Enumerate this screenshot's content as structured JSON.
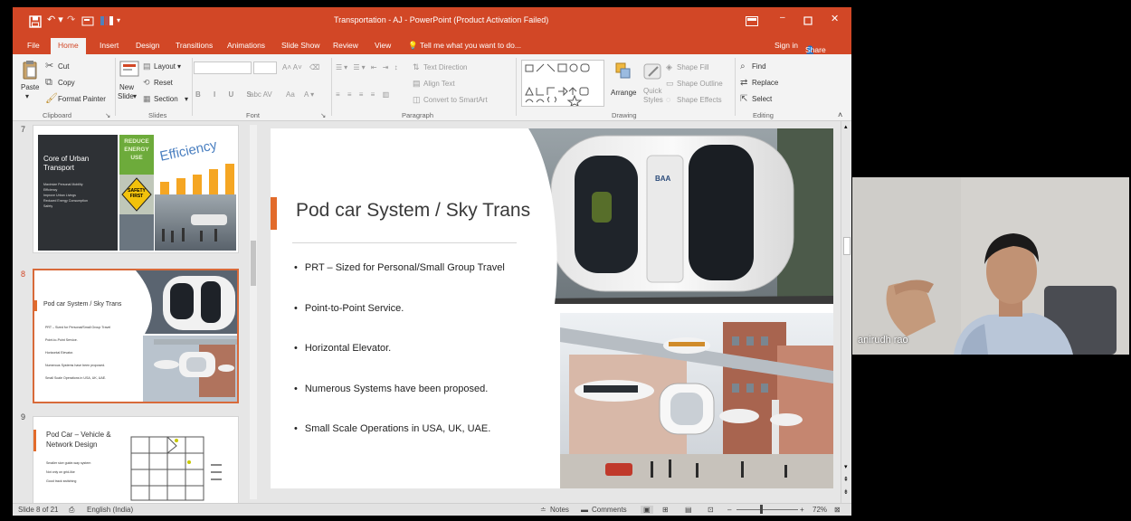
{
  "window": {
    "title": "Transportation - AJ - PowerPoint (Product Activation Failed)",
    "sign_in": "Sign in",
    "share": "Share"
  },
  "tabs": [
    "File",
    "Home",
    "Insert",
    "Design",
    "Transitions",
    "Animations",
    "Slide Show",
    "Review",
    "View"
  ],
  "active_tab": "Home",
  "tell_me": "Tell me what you want to do...",
  "ribbon": {
    "clipboard": {
      "paste": "Paste",
      "cut": "Cut",
      "copy": "Copy",
      "format_painter": "Format Painter",
      "group": "Clipboard"
    },
    "slides": {
      "new_slide": "New",
      "new_slide2": "Slide",
      "layout": "Layout",
      "reset": "Reset",
      "section": "Section",
      "group": "Slides"
    },
    "font": {
      "group": "Font",
      "aa": "Aa"
    },
    "paragraph": {
      "text_direction": "Text Direction",
      "align_text": "Align Text",
      "convert": "Convert to SmartArt",
      "group": "Paragraph"
    },
    "drawing": {
      "arrange": "Arrange",
      "quick_styles": "Quick",
      "quick_styles2": "Styles",
      "shape_fill": "Shape Fill",
      "shape_outline": "Shape Outline",
      "shape_effects": "Shape Effects",
      "group": "Drawing"
    },
    "editing": {
      "find": "Find",
      "replace": "Replace",
      "select": "Select",
      "group": "Editing"
    }
  },
  "thumbnails": [
    {
      "number": "7",
      "title": "Core of Urban Transport",
      "bullets": [
        "Maximize Personal Mobility",
        "Efficiency",
        "Improve Urban Livings",
        "Reduced Energy Consumption",
        "Safety"
      ],
      "efficiency": "Efficiency",
      "reduce": "REDUCE",
      "energy": "ENERGY",
      "use": "USE",
      "safety": "SAFETY",
      "first": "FIRST"
    },
    {
      "number": "8",
      "title": "Pod car System / Sky Trans",
      "bullets": [
        "PRT – Sized for Personal/Small Group Travel",
        "Point-to-Point Service.",
        "Horizontal Elevator.",
        "Numerous Systems have been proposed.",
        "Small Scale Operations in USA, UK, UAE."
      ]
    },
    {
      "number": "9",
      "title": "Pod Car – Vehicle & Network Design",
      "bullets": [
        "Smaller size guide-way system",
        "Not only on grid-like",
        "Good track switching"
      ]
    }
  ],
  "slide": {
    "title": "Pod car System / Sky Trans",
    "bullets": [
      "PRT – Sized for Personal/Small Group Travel",
      "Point-to-Point Service.",
      "Horizontal Elevator.",
      "Numerous Systems have been proposed.",
      "Small Scale Operations in USA, UK, UAE."
    ],
    "pod_brand": "BAA"
  },
  "status": {
    "slide_of": "Slide 8 of 21",
    "language": "English (India)",
    "notes": "Notes",
    "comments": "Comments",
    "zoom": "72%"
  },
  "webcam": {
    "name": "anirudh rao"
  },
  "colors": {
    "accent": "#d24726",
    "slide_accent": "#e26b2b"
  }
}
